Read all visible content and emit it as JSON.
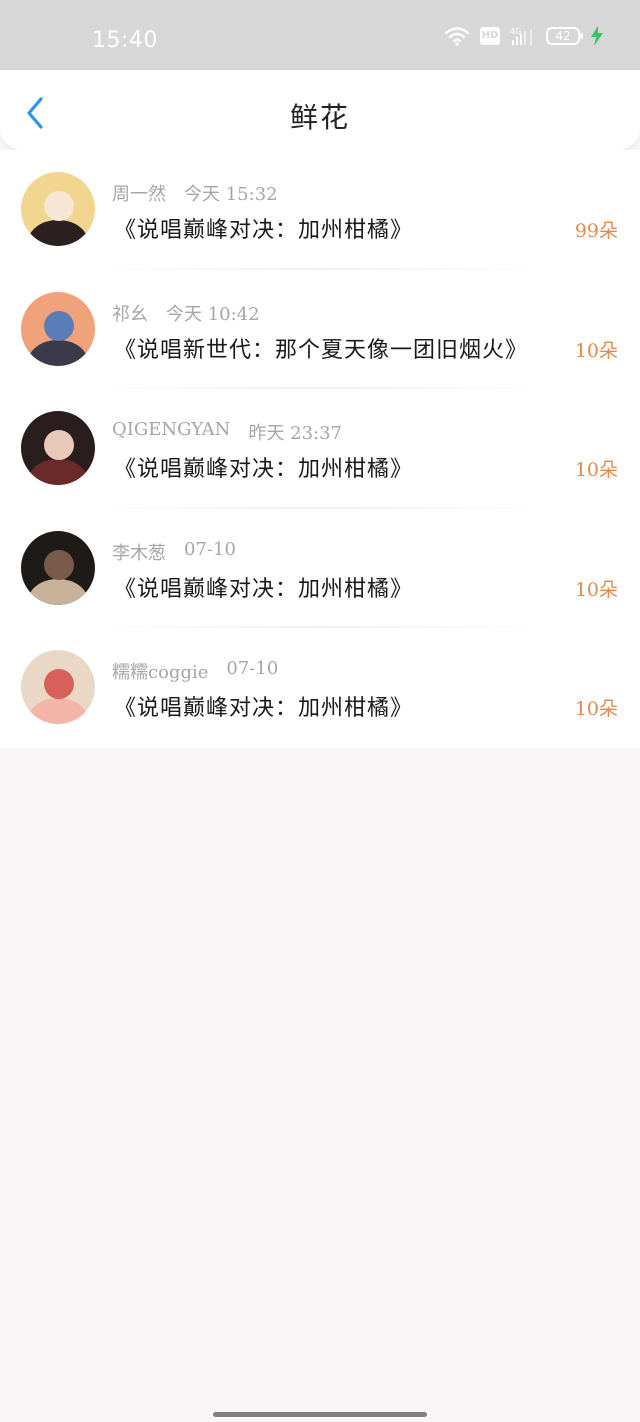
{
  "status_bar": {
    "time": "15:40",
    "network": "4G",
    "hd": "HD",
    "battery": "42",
    "icons": [
      "wifi-icon",
      "hd-icon",
      "signal-icon",
      "battery-icon",
      "charging-icon"
    ],
    "charge_color": "#33c46a"
  },
  "header": {
    "title": "鲜花",
    "back_icon": "chevron-left-icon",
    "accent": "#2a95e6"
  },
  "list": {
    "accent_count_color": "#e38a4b",
    "items": [
      {
        "user": "周一然",
        "time": "今天 15:32",
        "song": "《说唱巅峰对决：加州柑橘》",
        "count": "99朵",
        "avatar_colors": [
          "#f2d58f",
          "#f7e6d4",
          "#2b2020"
        ]
      },
      {
        "user": "祁幺",
        "time": "今天 10:42",
        "song": "《说唱新世代：那个夏天像一团旧烟火》",
        "count": "10朵",
        "avatar_colors": [
          "#f0a27a",
          "#5a7db8",
          "#3a3a4a"
        ]
      },
      {
        "user": "QIGENGYAN",
        "time": "昨天 23:37",
        "song": "《说唱巅峰对决：加州柑橘》",
        "count": "10朵",
        "avatar_colors": [
          "#2a1d1d",
          "#e8c8b8",
          "#6b2a2a"
        ]
      },
      {
        "user": "李木葱",
        "time": "07-10",
        "song": "《说唱巅峰对决：加州柑橘》",
        "count": "10朵",
        "avatar_colors": [
          "#1e1a18",
          "#7a5a48",
          "#c9b29a"
        ]
      },
      {
        "user": "糯糯coggie",
        "time": "07-10",
        "song": "《说唱巅峰对决：加州柑橘》",
        "count": "10朵",
        "avatar_colors": [
          "#e9d8c6",
          "#d8605a",
          "#f2b5a8"
        ]
      }
    ]
  }
}
